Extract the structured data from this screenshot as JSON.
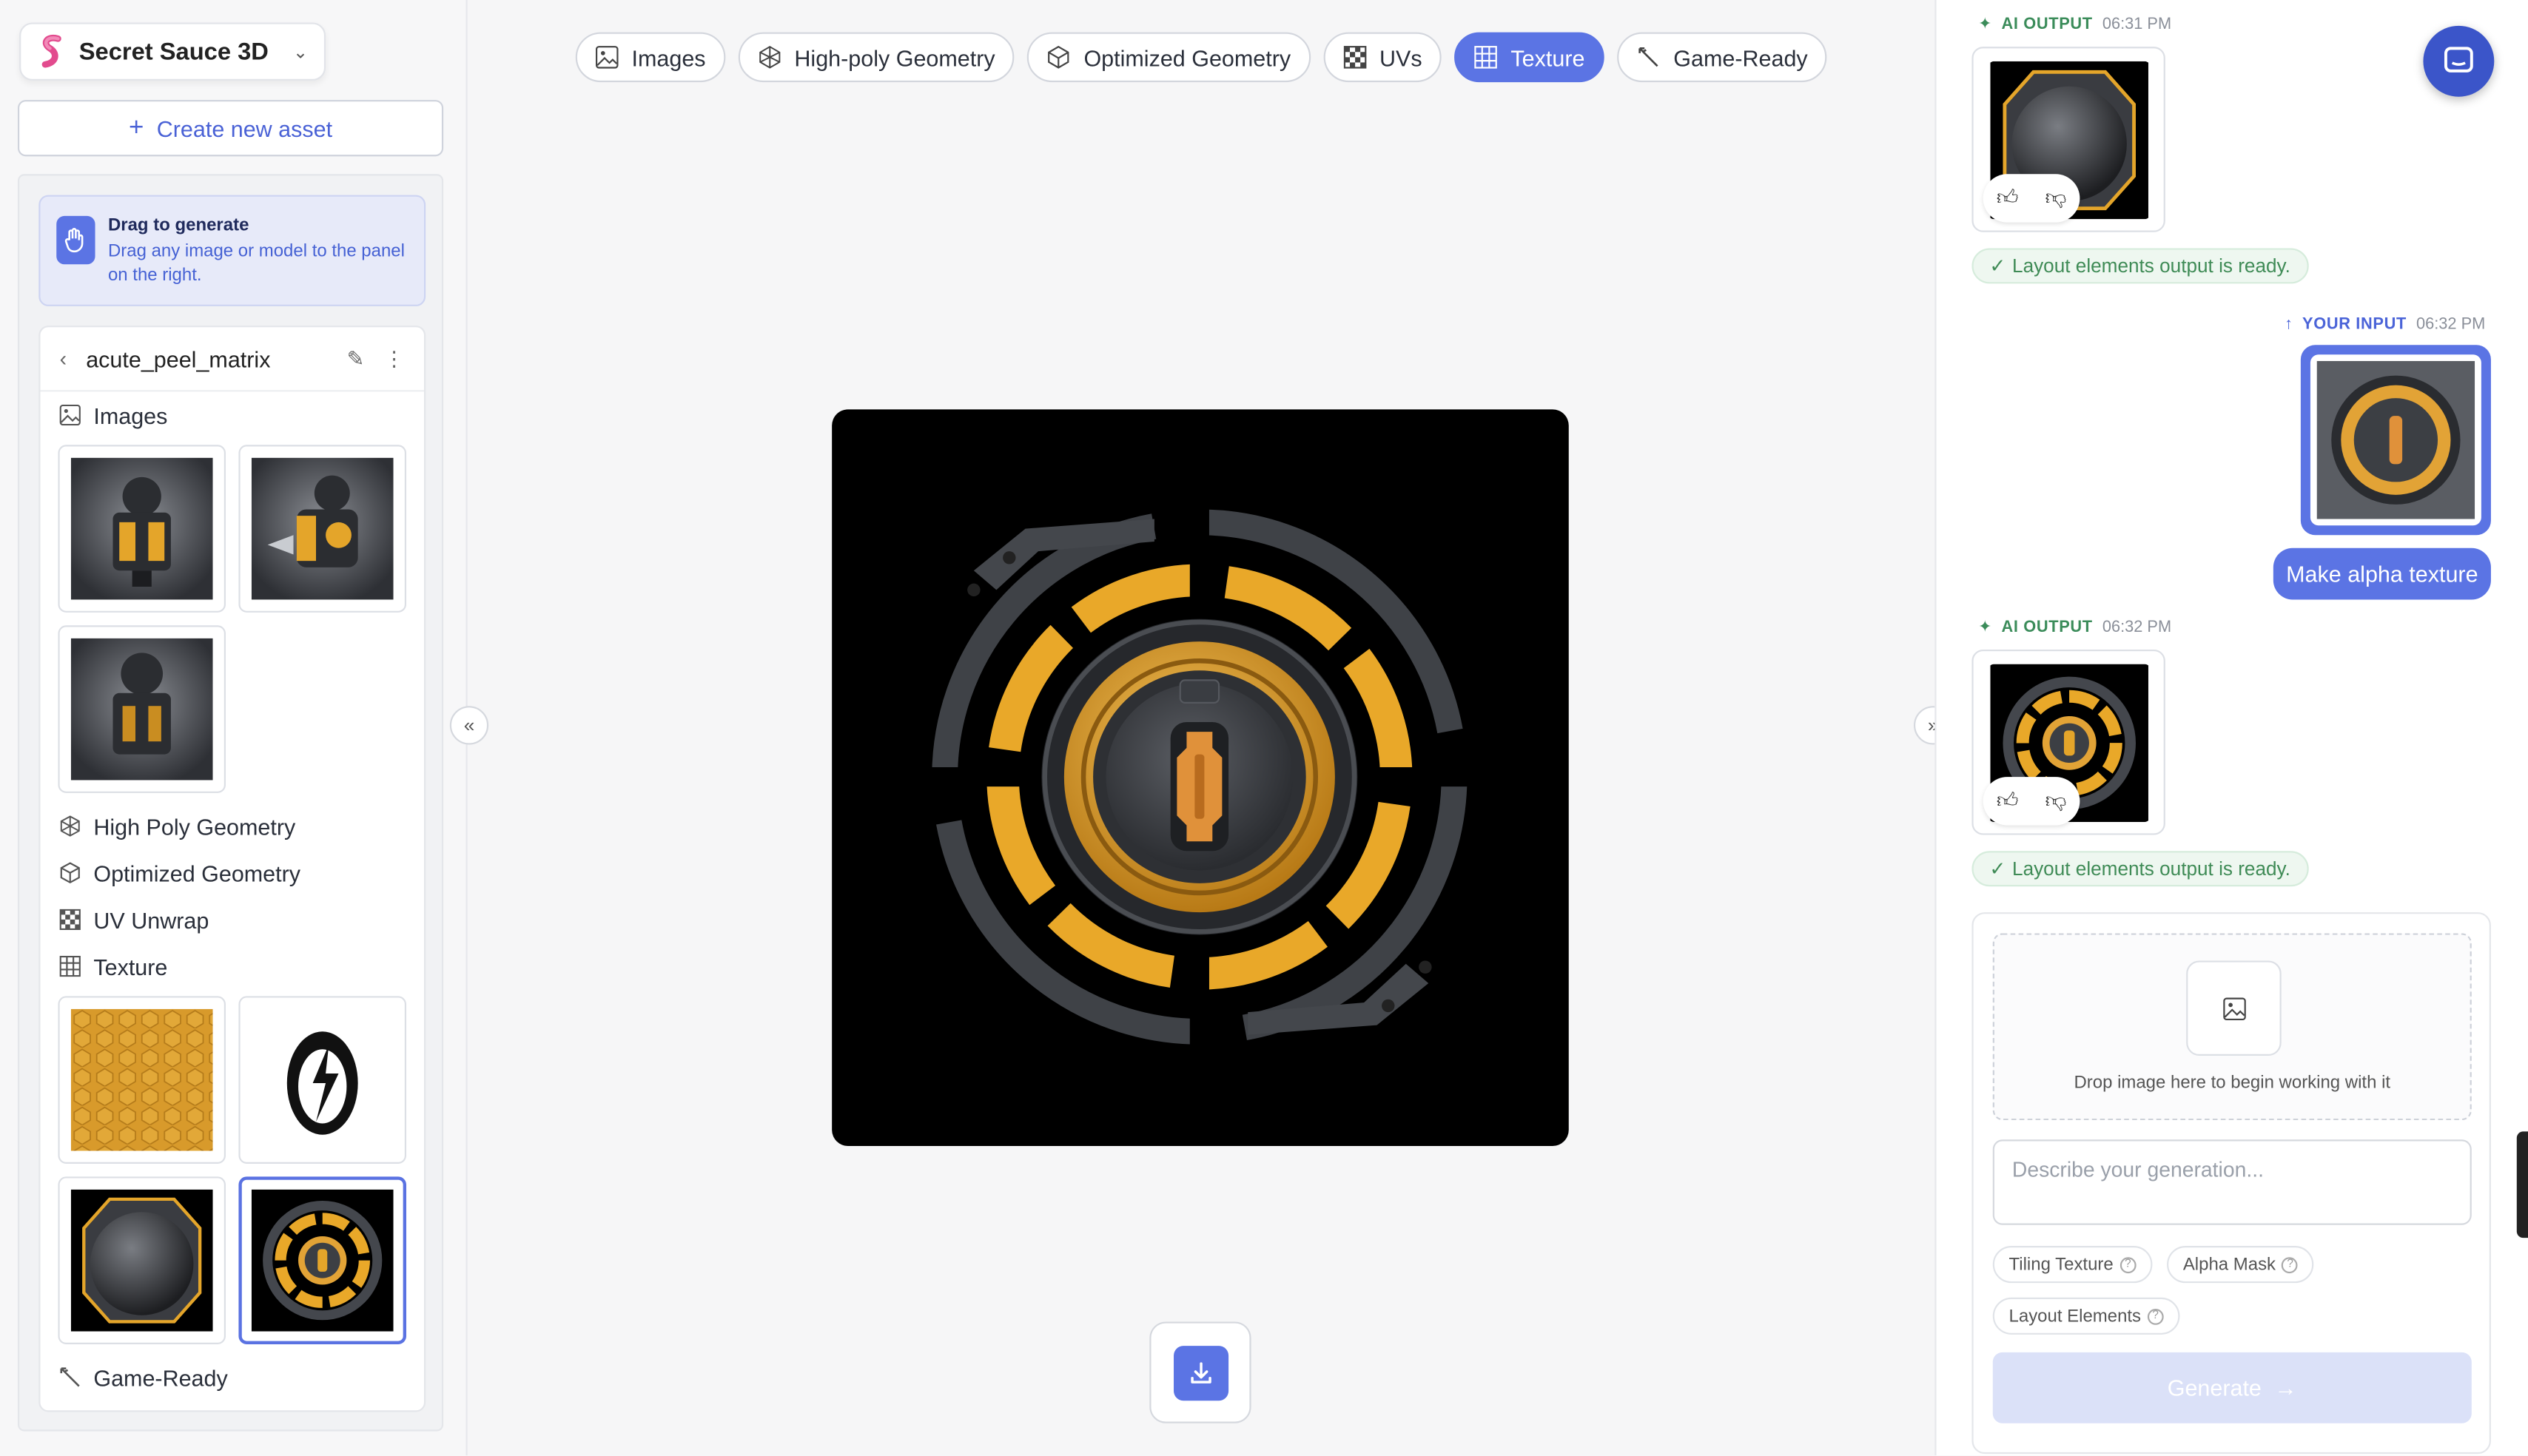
{
  "app": {
    "title": "Secret Sauce 3D",
    "create_label": "Create new asset"
  },
  "drag": {
    "title": "Drag to generate",
    "body": "Drag any image or model to the panel on the right."
  },
  "asset": {
    "name": "acute_peel_matrix",
    "sections": {
      "images": "Images",
      "high_poly": "High Poly Geometry",
      "optimized": "Optimized Geometry",
      "uv": "UV Unwrap",
      "texture": "Texture",
      "game_ready": "Game-Ready"
    }
  },
  "tabs": [
    {
      "label": "Images",
      "icon": "image-icon",
      "active": false
    },
    {
      "label": "High-poly Geometry",
      "icon": "high-poly-icon",
      "active": false
    },
    {
      "label": "Optimized Geometry",
      "icon": "cube-icon",
      "active": false
    },
    {
      "label": "UVs",
      "icon": "checker-icon",
      "active": false
    },
    {
      "label": "Texture",
      "icon": "grid-icon",
      "active": true
    },
    {
      "label": "Game-Ready",
      "icon": "wand-icon",
      "active": false
    }
  ],
  "chat": {
    "ai_label": "AI OUTPUT",
    "your_label": "YOUR INPUT",
    "t1": "06:31 PM",
    "t2": "06:32 PM",
    "t3": "06:32 PM",
    "ready_text": "Layout elements output is ready.",
    "prompt_text": "Make alpha texture"
  },
  "composer": {
    "drop_text": "Drop image here to begin working with it",
    "placeholder": "Describe your generation...",
    "chips": [
      "Tiling Texture",
      "Alpha Mask",
      "Layout Elements"
    ],
    "generate_label": "Generate"
  },
  "colors": {
    "accent": "#5b74e4",
    "gold": "#e9a829",
    "success": "#3f8b56"
  }
}
